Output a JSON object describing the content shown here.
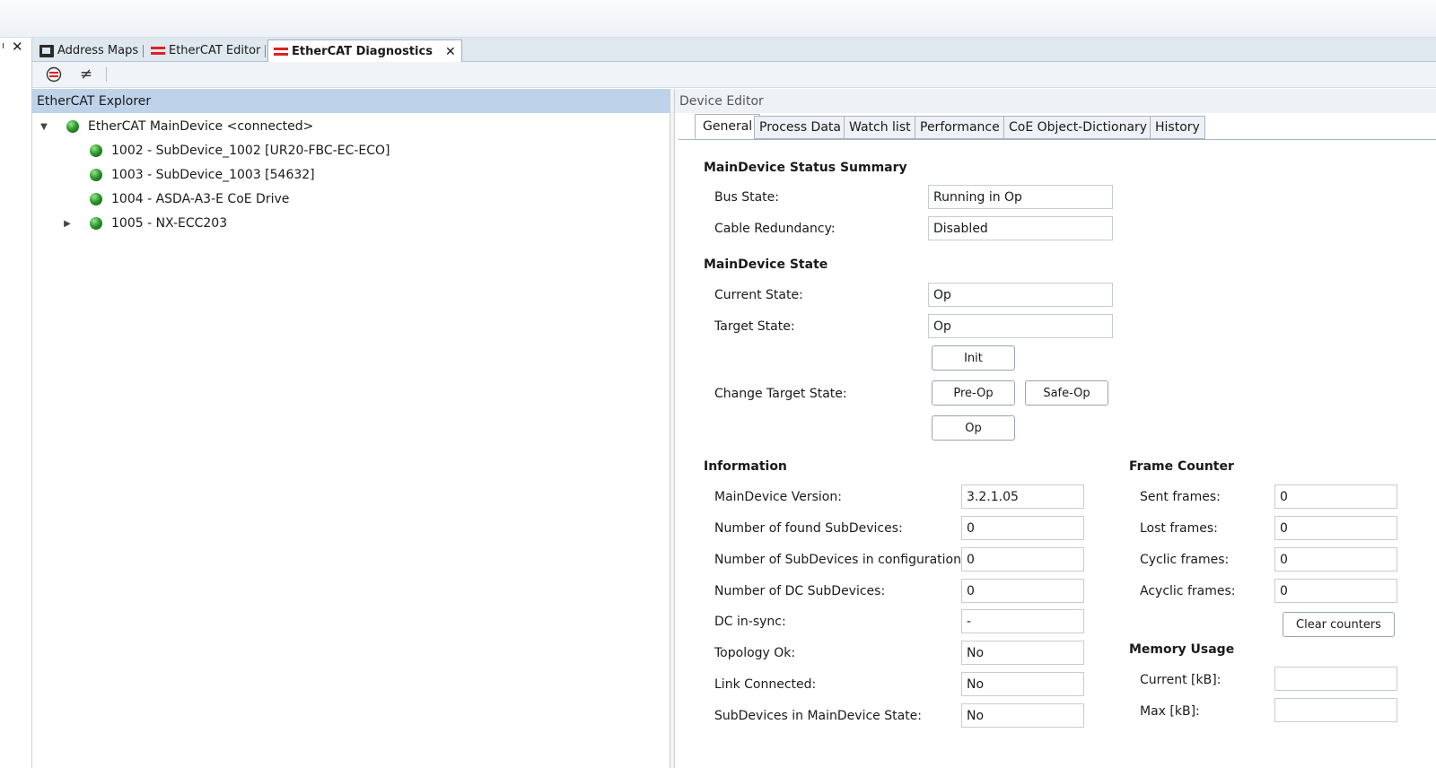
{
  "document_tabs": [
    {
      "label": "Address Maps",
      "icon": "address-map-icon"
    },
    {
      "label": "EtherCAT Editor",
      "icon": "ethercat-icon"
    },
    {
      "label": "EtherCAT Diagnostics",
      "icon": "ethercat-diagnostics-icon",
      "active": true
    }
  ],
  "toolbar": {
    "icons": [
      "ethercat-connect-icon",
      "not-equal-icon"
    ]
  },
  "explorer": {
    "title": "EtherCAT Explorer",
    "root": "EtherCAT MainDevice <connected>",
    "children": [
      "1002 - SubDevice_1002 [UR20-FBC-EC-ECO]",
      "1003 - SubDevice_1003 [54632]",
      "1004 - ASDA-A3-E CoE Drive",
      "1005 - NX-ECC203"
    ]
  },
  "editor": {
    "title": "Device Editor",
    "tabs": [
      "General",
      "Process Data",
      "Watch list",
      "Performance",
      "CoE Object-Dictionary",
      "History"
    ],
    "status_summary": {
      "title": "MainDevice Status Summary",
      "bus_state_label": "Bus State:",
      "bus_state": "Running in Op",
      "cable_redundancy_label": "Cable Redundancy:",
      "cable_redundancy": "Disabled"
    },
    "state": {
      "title": "MainDevice State",
      "current_label": "Current State:",
      "current": "Op",
      "target_label": "Target State:",
      "target": "Op",
      "change_label": "Change Target State:",
      "buttons": {
        "init": "Init",
        "preop": "Pre-Op",
        "safeop": "Safe-Op",
        "op": "Op"
      }
    },
    "information": {
      "title": "Information",
      "rows": [
        {
          "label": "MainDevice Version:",
          "value": "3.2.1.05"
        },
        {
          "label": "Number of found SubDevices:",
          "value": "0"
        },
        {
          "label": "Number of SubDevices in configuration:",
          "value": "0"
        },
        {
          "label": "Number of DC SubDevices:",
          "value": "0"
        },
        {
          "label": "DC in-sync:",
          "value": "-"
        },
        {
          "label": "Topology Ok:",
          "value": "No"
        },
        {
          "label": "Link Connected:",
          "value": "No"
        },
        {
          "label": "SubDevices in MainDevice State:",
          "value": "No"
        }
      ]
    },
    "frame_counter": {
      "title": "Frame Counter",
      "rows": [
        {
          "label": "Sent frames:",
          "value": "0"
        },
        {
          "label": "Lost frames:",
          "value": "0"
        },
        {
          "label": "Cyclic frames:",
          "value": "0"
        },
        {
          "label": "Acyclic frames:",
          "value": "0"
        }
      ],
      "clear_label": "Clear counters"
    },
    "memory": {
      "title": "Memory Usage",
      "rows": [
        {
          "label": "Current [kB]:",
          "value": ""
        },
        {
          "label": "Max [kB]:",
          "value": ""
        }
      ]
    }
  }
}
